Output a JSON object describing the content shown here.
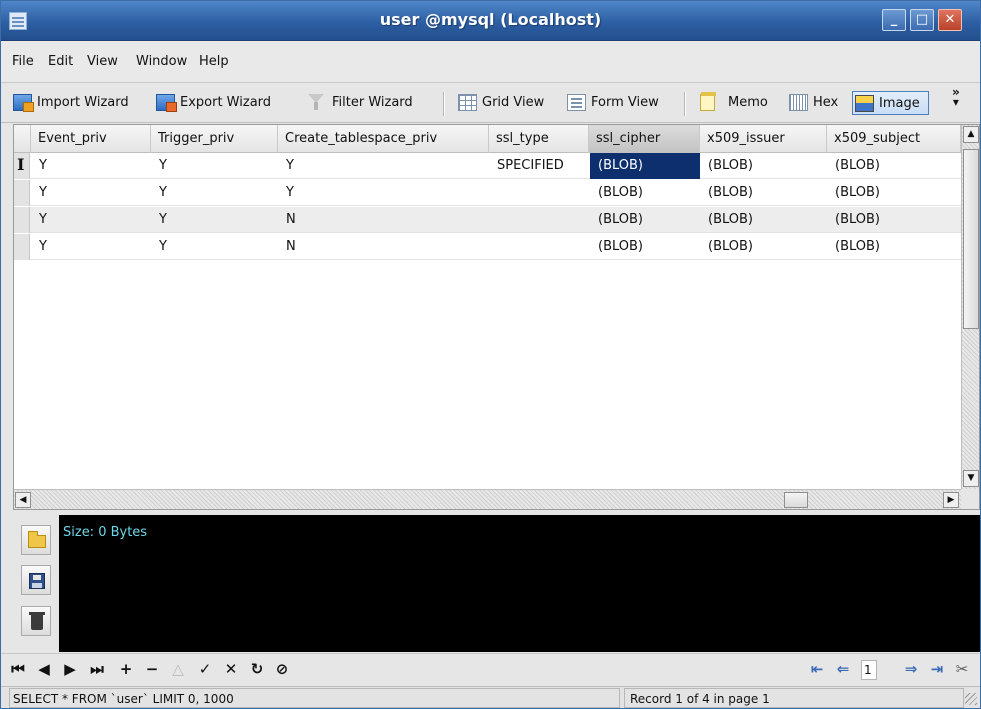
{
  "window": {
    "title": "user @mysql (Localhost)",
    "controls": {
      "minimize": "_",
      "maximize": "□",
      "close": "✕"
    }
  },
  "menubar": [
    "File",
    "Edit",
    "View",
    "Window",
    "Help"
  ],
  "toolbar": {
    "import": "Import Wizard",
    "export": "Export Wizard",
    "filter": "Filter Wizard",
    "grid_view": "Grid View",
    "form_view": "Form View",
    "memo": "Memo",
    "hex": "Hex",
    "image": "Image",
    "overflow": "»"
  },
  "grid": {
    "columns": [
      "Event_priv",
      "Trigger_priv",
      "Create_tablespace_priv",
      "ssl_type",
      "ssl_cipher",
      "x509_issuer",
      "x509_subject"
    ],
    "rows": [
      [
        "Y",
        "Y",
        "Y",
        "SPECIFIED",
        "(BLOB)",
        "(BLOB)",
        "(BLOB)"
      ],
      [
        "Y",
        "Y",
        "Y",
        "",
        "(BLOB)",
        "(BLOB)",
        "(BLOB)"
      ],
      [
        "Y",
        "Y",
        "N",
        "",
        "(BLOB)",
        "(BLOB)",
        "(BLOB)"
      ],
      [
        "Y",
        "Y",
        "N",
        "",
        "(BLOB)",
        "(BLOB)",
        "(BLOB)"
      ]
    ],
    "selected_column": "ssl_cipher",
    "row_cursor": "I",
    "selection_color": "#0e2f6e"
  },
  "blob_panel": {
    "size_label": "Size: 0 Bytes",
    "tools": [
      "folder-icon",
      "save-icon",
      "trash-icon"
    ]
  },
  "navbar": {
    "first": "⏮",
    "prev": "◀",
    "next": "▶",
    "last": "⏭",
    "add": "+",
    "delete": "−",
    "edit": "△",
    "apply": "✓",
    "cancel": "✕",
    "refresh": "↻",
    "stop": "⊘",
    "page_first": "⇤",
    "page_prev": "⇐",
    "page_number": "1",
    "page_next": "⇒",
    "page_last": "⇥",
    "settings": "✂"
  },
  "statusbar": {
    "sql": "SELECT * FROM `user` LIMIT 0, 1000",
    "record": "Record 1 of 4 in page 1"
  }
}
